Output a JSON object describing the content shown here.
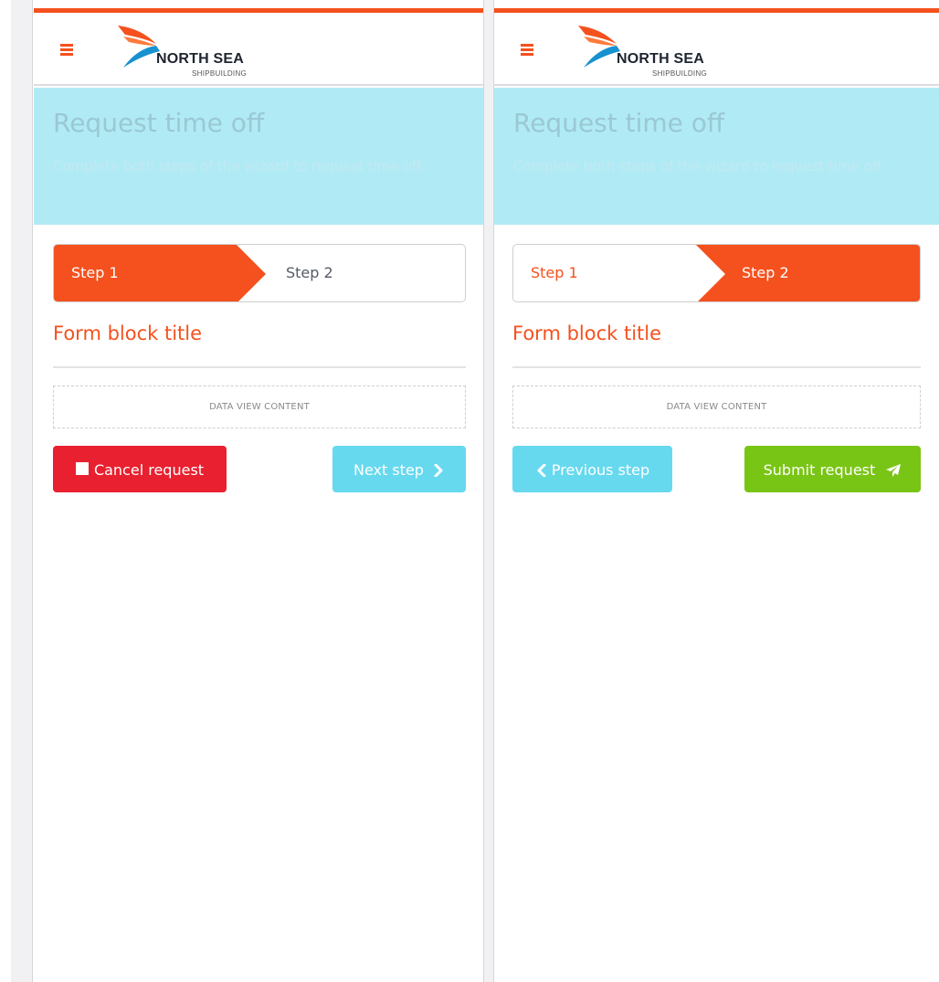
{
  "colors": {
    "accent": "#f4511e",
    "hero_bg": "#b0eaf5",
    "cancel": "#e8202f",
    "info": "#66d9ef",
    "success": "#79c515"
  },
  "logo": {
    "name": "NORTH SEA",
    "sub": "SHIPBUILDING"
  },
  "screens": [
    {
      "menu_icon": "hamburger-menu-icon",
      "page_title": "Request time off",
      "page_subtitle": "Complete both steps of the wizard to request time off.",
      "steps": [
        {
          "label": "Step 1",
          "active": true
        },
        {
          "label": "Step 2",
          "active": false
        }
      ],
      "form_block_title": "Form block title",
      "data_view_placeholder": "DATA VIEW CONTENT",
      "buttons": {
        "secondary_label": "Cancel request",
        "secondary_icon": "stop-square-icon",
        "primary_label": "Next step",
        "primary_icon": "chevron-right-icon"
      }
    },
    {
      "menu_icon": "hamburger-menu-icon",
      "page_title": "Request time off",
      "page_subtitle": "Complete both steps of the wizard to request time off.",
      "steps": [
        {
          "label": "Step 1",
          "active": false
        },
        {
          "label": "Step 2",
          "active": true
        }
      ],
      "form_block_title": "Form block title",
      "data_view_placeholder": "DATA VIEW CONTENT",
      "buttons": {
        "secondary_label": "Previous step",
        "secondary_icon": "chevron-left-icon",
        "primary_label": "Submit request",
        "primary_icon": "paper-plane-icon"
      }
    }
  ]
}
